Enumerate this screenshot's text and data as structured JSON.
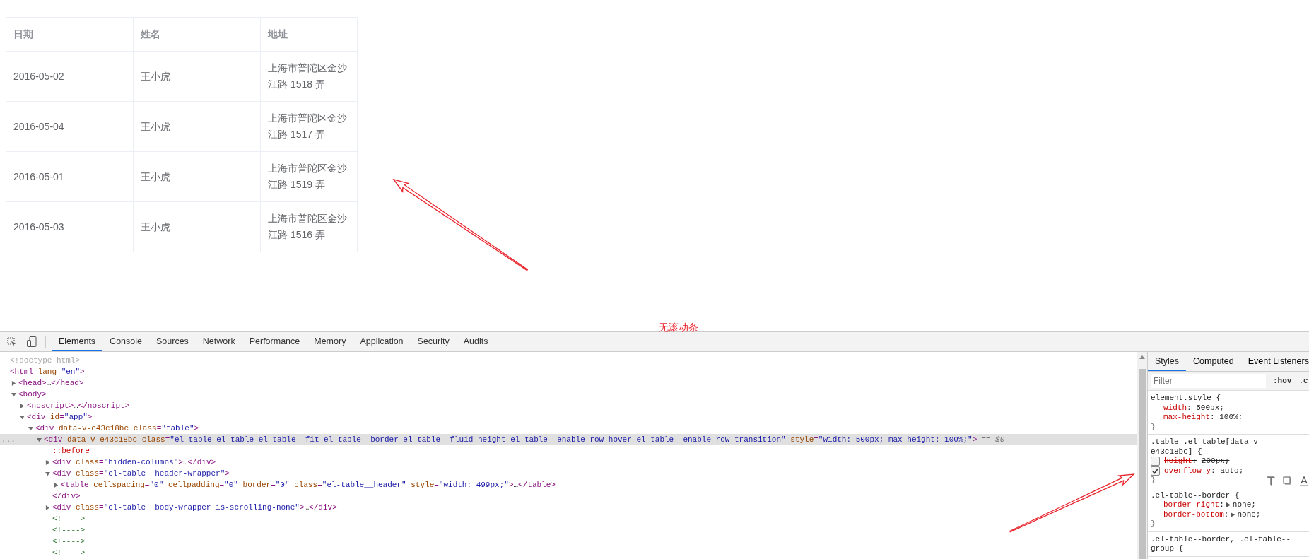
{
  "table": {
    "columns": [
      "日期",
      "姓名",
      "地址"
    ],
    "rows": [
      {
        "date": "2016-05-02",
        "name": "王小虎",
        "address": "上海市普陀区金沙江路 1518 弄"
      },
      {
        "date": "2016-05-04",
        "name": "王小虎",
        "address": "上海市普陀区金沙江路 1517 弄"
      },
      {
        "date": "2016-05-01",
        "name": "王小虎",
        "address": "上海市普陀区金沙江路 1519 弄"
      },
      {
        "date": "2016-05-03",
        "name": "王小虎",
        "address": "上海市普陀区金沙江路 1516 弄"
      }
    ]
  },
  "annotation_label": "无滚动条",
  "devtools": {
    "tabs": [
      {
        "label": "Elements",
        "selected": true
      },
      {
        "label": "Console",
        "selected": false
      },
      {
        "label": "Sources",
        "selected": false
      },
      {
        "label": "Network",
        "selected": false
      },
      {
        "label": "Performance",
        "selected": false
      },
      {
        "label": "Memory",
        "selected": false
      },
      {
        "label": "Application",
        "selected": false
      },
      {
        "label": "Security",
        "selected": false
      },
      {
        "label": "Audits",
        "selected": false
      }
    ],
    "elements": {
      "row_menu": "...",
      "selected_suffix": "== $0",
      "tree": [
        {
          "kind": "doctype",
          "text": "<!doctype html>",
          "selected": false
        },
        {
          "kind": "element",
          "text": "<html lang=\"en\">",
          "selected": false,
          "children": [
            {
              "kind": "element",
              "text": "<head>…</head>",
              "expanded": false,
              "selected": false
            },
            {
              "kind": "element",
              "text": "<body>",
              "expanded": true,
              "selected": false,
              "children": [
                {
                  "kind": "element",
                  "text": "<noscript>…</noscript>",
                  "expanded": false,
                  "selected": false
                },
                {
                  "kind": "element",
                  "text": "<div id=\"app\">",
                  "expanded": true,
                  "selected": false,
                  "children": [
                    {
                      "kind": "element",
                      "text": "<div data-v-e43c18bc class=\"table\">",
                      "expanded": true,
                      "selected": false,
                      "children": [
                        {
                          "kind": "element",
                          "text": "<div data-v-e43c18bc class=\"el-table el_table el-table--fit el-table--border el-table--fluid-height el-table--enable-row-hover el-table--enable-row-transition\" style=\"width: 500px; max-height: 100%;\">",
                          "expanded": true,
                          "selected": true,
                          "children": [
                            {
                              "kind": "pseudo",
                              "text": "::before",
                              "selected": false
                            },
                            {
                              "kind": "element",
                              "text": "<div class=\"hidden-columns\">…</div>",
                              "expanded": false,
                              "selected": false
                            },
                            {
                              "kind": "element",
                              "text": "<div class=\"el-table__header-wrapper\">",
                              "expanded": true,
                              "selected": false,
                              "closing": "</div>",
                              "children": [
                                {
                                  "kind": "element",
                                  "text": "<table cellspacing=\"0\" cellpadding=\"0\" border=\"0\" class=\"el-table__header\" style=\"width: 499px;\">…</table>",
                                  "expanded": false,
                                  "selected": false
                                }
                              ]
                            },
                            {
                              "kind": "element",
                              "text": "<div class=\"el-table__body-wrapper is-scrolling-none\">…</div>",
                              "expanded": false,
                              "selected": false
                            },
                            {
                              "kind": "comment",
                              "text": "<!---->",
                              "selected": false
                            },
                            {
                              "kind": "comment",
                              "text": "<!---->",
                              "selected": false
                            },
                            {
                              "kind": "comment",
                              "text": "<!---->",
                              "selected": false
                            },
                            {
                              "kind": "comment",
                              "text": "<!---->",
                              "selected": false
                            }
                          ]
                        }
                      ]
                    }
                  ]
                }
              ]
            }
          ]
        }
      ]
    },
    "styles": {
      "tabs": [
        {
          "label": "Styles",
          "selected": true
        },
        {
          "label": "Computed",
          "selected": false
        },
        {
          "label": "Event Listeners",
          "selected": false
        }
      ],
      "filter": {
        "placeholder": "Filter"
      },
      "buttons": [
        ":hov",
        ".c"
      ],
      "rules": [
        {
          "selector": "element.style {",
          "close": "}",
          "properties": [
            {
              "name": "width",
              "sep": ":",
              "value": "500px;"
            },
            {
              "name": "max-height",
              "sep": ":",
              "value": "100%;"
            }
          ]
        },
        {
          "selector": ".table .el-table[data-v-e43c18bc] {",
          "close": "}",
          "hover_tools": true,
          "properties": [
            {
              "name": "height",
              "sep": ":",
              "value": "200px;",
              "checked": false
            },
            {
              "name": "overflow-y",
              "sep": ":",
              "value": "auto;",
              "checked": true
            }
          ]
        },
        {
          "selector": ".el-table--border {",
          "close": "}",
          "properties": [
            {
              "name": "border-right",
              "sep": ":",
              "value": "none;",
              "expandable": true
            },
            {
              "name": "border-bottom",
              "sep": ":",
              "value": "none;",
              "expandable": true
            }
          ]
        },
        {
          "selector": ".el-table--border, .el-table--group {"
        }
      ]
    }
  }
}
